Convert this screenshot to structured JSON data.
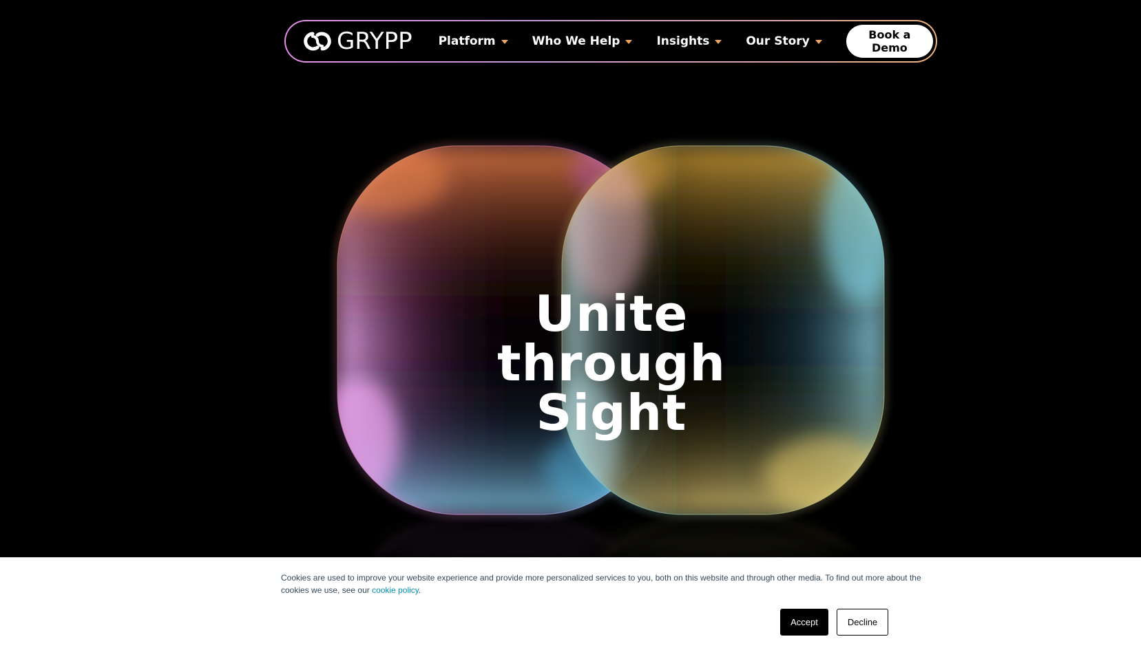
{
  "brand": {
    "name": "GRYPP",
    "logo_icon": "interlocking-rings-icon"
  },
  "nav": {
    "items": [
      {
        "label": "Platform",
        "icon": "chevron-down-icon"
      },
      {
        "label": "Who We Help",
        "icon": "chevron-down-icon"
      },
      {
        "label": "Insights",
        "icon": "chevron-down-icon"
      },
      {
        "label": "Our Story",
        "icon": "chevron-down-icon"
      }
    ],
    "cta_label": "Book a Demo",
    "caret_color": "#f0a55e",
    "border_gradient": [
      "#e58ee8",
      "#f0b47a"
    ]
  },
  "hero": {
    "headline_line1": "Unite",
    "headline_line2": "through",
    "headline_line3": "Sight",
    "left_shape_colors": [
      "#ff9a4f",
      "#f2a3f5",
      "#6fd3ff"
    ],
    "right_shape_colors": [
      "#f2b34a",
      "#7fd9ef",
      "#f3d26a"
    ]
  },
  "cookie_banner": {
    "text": "Cookies are used to improve your website experience and provide more personalized services to you, both on this website and through other media. To find out more about the cookies we use, see our ",
    "link_text": "cookie policy",
    "after_link": ".",
    "accept_label": "Accept",
    "decline_label": "Decline",
    "link_color": "#0091ae"
  }
}
